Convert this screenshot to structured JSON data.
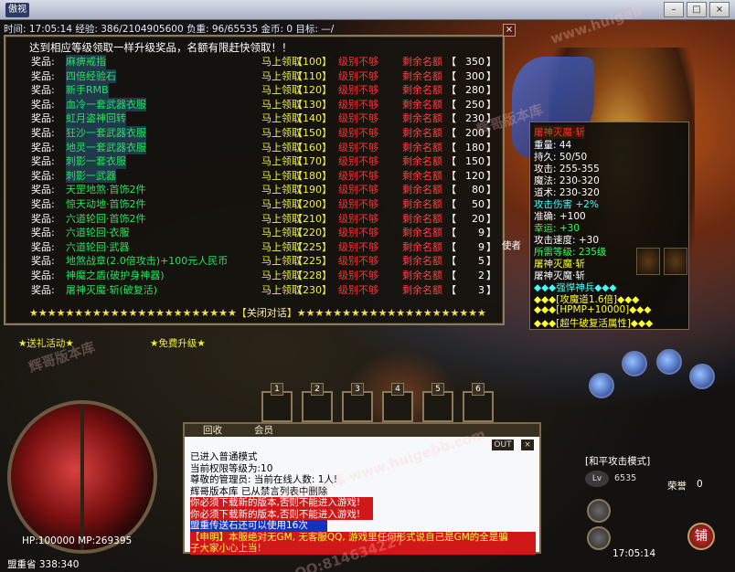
{
  "window": {
    "title_logo": "傲视",
    "minimize": "–",
    "maximize": "□",
    "close": "×"
  },
  "infobar": "时间: 17:05:14  经验: 386/2104905600  负重: 96/65535  金币: 0  目标: —/",
  "reward_panel": {
    "header": "达到相应等级领取一样升级奖品，名额有限赶快领取！！",
    "rows": [
      {
        "key": "奖品:",
        "name": "麻痹戒指",
        "button": "马上领取",
        "level": "【100】",
        "status": "级别不够",
        "remain_label": "剩余名额",
        "count": "350"
      },
      {
        "key": "奖品:",
        "name": "四倍经验石",
        "button": "马上领取",
        "level": "【110】",
        "status": "级别不够",
        "remain_label": "剩余名额",
        "count": "300"
      },
      {
        "key": "奖品:",
        "name": "新手RMB",
        "button": "马上领取",
        "level": "【120】",
        "status": "级别不够",
        "remain_label": "剩余名额",
        "count": "280"
      },
      {
        "key": "奖品:",
        "name": "血冷一套武器衣服",
        "button": "马上领取",
        "level": "【130】",
        "status": "级别不够",
        "remain_label": "剩余名额",
        "count": "250"
      },
      {
        "key": "奖品:",
        "name": "虹月盗神回转",
        "button": "马上领取",
        "level": "【140】",
        "status": "级别不够",
        "remain_label": "剩余名额",
        "count": "230"
      },
      {
        "key": "奖品:",
        "name": "狂沙一套武器衣服",
        "button": "马上领取",
        "level": "【150】",
        "status": "级别不够",
        "remain_label": "剩余名额",
        "count": "200"
      },
      {
        "key": "奖品:",
        "name": "地灵一套武器衣服",
        "button": "马上领取",
        "level": "【160】",
        "status": "级别不够",
        "remain_label": "剩余名额",
        "count": "180"
      },
      {
        "key": "奖品:",
        "name": "刺影一套衣服",
        "button": "马上领取",
        "level": "【170】",
        "status": "级别不够",
        "remain_label": "剩余名额",
        "count": "150"
      },
      {
        "key": "奖品:",
        "name": "刺影一武器",
        "button": "马上领取",
        "level": "【180】",
        "status": "级别不够",
        "remain_label": "剩余名额",
        "count": "120"
      },
      {
        "key": "奖品:",
        "name": "天罡地煞·首饰2件",
        "button": "马上领取",
        "level": "【190】",
        "status": "级别不够",
        "remain_label": "剩余名额",
        "count": "80"
      },
      {
        "key": "奖品:",
        "name": "惊天动地·首饰2件",
        "button": "马上领取",
        "level": "【200】",
        "status": "级别不够",
        "remain_label": "剩余名额",
        "count": "50"
      },
      {
        "key": "奖品:",
        "name": "六道轮回·首饰2件",
        "button": "马上领取",
        "level": "【210】",
        "status": "级别不够",
        "remain_label": "剩余名额",
        "count": "20"
      },
      {
        "key": "奖品:",
        "name": "六道轮回·衣服",
        "button": "马上领取",
        "level": "【220】",
        "status": "级别不够",
        "remain_label": "剩余名额",
        "count": "9"
      },
      {
        "key": "奖品:",
        "name": "六道轮回·武器",
        "button": "马上领取",
        "level": "【225】",
        "status": "级别不够",
        "remain_label": "剩余名额",
        "count": "9"
      },
      {
        "key": "奖品:",
        "name": "地煞战章(2.0倍攻击)+100元人民币",
        "button": "马上领取",
        "level": "【225】",
        "status": "级别不够",
        "remain_label": "剩余名额",
        "count": "5"
      },
      {
        "key": "奖品:",
        "name": "神魔之盾(破护身神器)",
        "button": "马上领取",
        "level": "【228】",
        "status": "级别不够",
        "remain_label": "剩余名额",
        "count": "2"
      },
      {
        "key": "奖品:",
        "name": "屠神灭魔·斩(破复活)",
        "button": "马上领取",
        "level": "【230】",
        "status": "级别不够",
        "remain_label": "剩余名额",
        "count": "3"
      }
    ],
    "footer_stars_left": "★★★★★★★★★★★★★★★★★★★★★★★【",
    "footer_close": "关闭对话",
    "footer_stars_right": "】★★★★★★★★★★★★★★★★★★★★★★★",
    "panel_close": "×"
  },
  "tooltip": {
    "name": "屠神灭魔·斩",
    "weight": "重量: 44",
    "durability": "持久: 50/50",
    "attack": "攻击: 255-355",
    "magic": "魔法: 230-320",
    "tao": "道术: 230-320",
    "attack_boost": "攻击伤害 +2%",
    "accuracy": "准确: +100",
    "luck": "幸运: +30",
    "attack_speed": "攻击速度: +30",
    "req_level": "所需等级: 235级",
    "series": "屠神灭魔·斩",
    "set_name": "屠神灭魔·斩",
    "title_line": "◆◆◆强悍神兵◆◆◆",
    "bonus1": "◆◆◆[攻魔道1.6倍]◆◆◆",
    "bonus2": "◆◆◆[HPMP+10000]◆◆◆",
    "bonus3": "◆◆◆[超牛破复活属性]◆◆◆"
  },
  "npc_label": "使者",
  "activities": {
    "left": "★送礼活动★",
    "right": "★免费升级★"
  },
  "chat": {
    "tab_back": "回收",
    "tab_member": "会员",
    "out": "OUT",
    "close": "×",
    "lines": [
      {
        "style": "dark",
        "text": "已进入普通模式"
      },
      {
        "style": "dark",
        "text": "当前权限等级为:10"
      },
      {
        "style": "dark",
        "text": "尊敬的管理员: 当前在线人数: 1人!"
      },
      {
        "style": "dark",
        "text": "辉哥版本库 已从禁言列表中删除"
      },
      {
        "style": "red",
        "text": "你必须下载新的版本,否则不能进入游戏!"
      },
      {
        "style": "red",
        "text": "你必须下载新的版本,否则不能进入游戏!"
      },
      {
        "style": "blue",
        "text": "盟重传送石还可以使用16次"
      },
      {
        "style": "redb",
        "text": "【申明】本服绝对无GM, 无客服QQ, 游戏里任何形式说自己是GM的全是骗"
      },
      {
        "style": "redb",
        "text": "子大家小心上当!"
      }
    ]
  },
  "hud": {
    "hp_mp": "HP:100000 MP:269395",
    "map": "盟重省 338:340",
    "mode": "[和平攻击模式]",
    "level": "Lv",
    "exp_val": "6535",
    "honor_label": "荣誉",
    "honor_value": "0",
    "clock": "17:05:14",
    "menu": "铺",
    "slot_numbers": [
      "1",
      "2",
      "3",
      "4",
      "5",
      "6"
    ]
  },
  "watermarks": [
    "辉哥版本库",
    "www.huigeb",
    "QQ:814634227",
    "辉哥版本库 www.huigebb.com",
    "QQ:814634227"
  ]
}
